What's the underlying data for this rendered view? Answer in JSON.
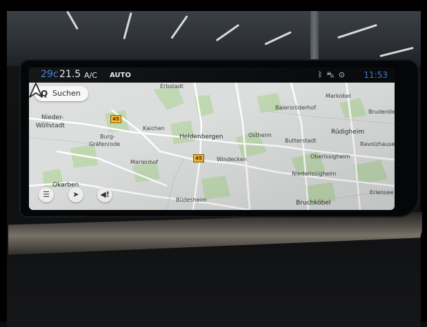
{
  "status_bar": {
    "outside_temp": "29c",
    "cabin_temp": "21.5",
    "ac_label": "A/C",
    "auto_label": "AUTO",
    "icons": [
      "bluetooth-icon",
      "car-icon",
      "location-signal-icon"
    ],
    "clock": "11:53"
  },
  "search": {
    "label": "Suchen",
    "icon": "search-icon"
  },
  "map_controls": [
    {
      "name": "menu-icon",
      "glyph": "☰"
    },
    {
      "name": "route-icon",
      "glyph": "➤"
    },
    {
      "name": "traffic-alert-icon",
      "glyph": "◀!"
    }
  ],
  "road_shields": [
    "45",
    "45"
  ],
  "places": {
    "erbstadt": "Erbstadt",
    "markoebel": "Markobel",
    "baiersroederhof": "Baiersröderhof",
    "bruderdiebach": "Bruderdieb",
    "nieder_woellstadt_1": "Nieder-",
    "nieder_woellstadt_2": "Wöllstadt",
    "kaichen": "Kaichen",
    "burg_graefenrode_1": "Burg-",
    "burg_graefenrode_2": "Gräfenrode",
    "heldenbergen": "Heldenbergen",
    "ostheim": "Ostheim",
    "butterstadt": "Butterstadt",
    "ruedigheim": "Rüdigheim",
    "ravolzhausen": "Ravolzhausen",
    "marienhof": "Marienhof",
    "windecken": "Windecken",
    "oberissigheim": "Oberissigheim",
    "niederissigheim": "Niederissigheim",
    "okarben": "Okarben",
    "erlensee": "Erlensee",
    "buedesheim": "Büdesheim",
    "bruchkoebel": "Bruchköbel"
  },
  "colors": {
    "accent_blue": "#3f7bd6",
    "map_background": "#dcdedd",
    "map_green": "#bcd8ab",
    "shield_yellow": "#f2b531"
  }
}
